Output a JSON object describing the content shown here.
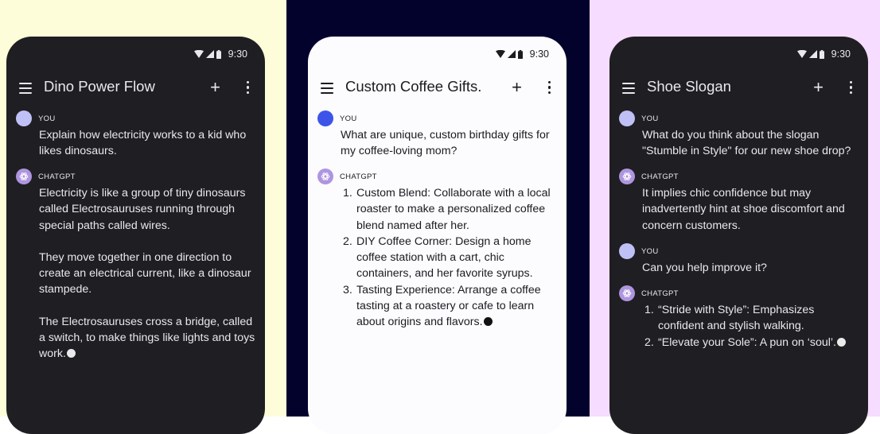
{
  "colors": {
    "bg_left": "#fdfdd9",
    "bg_mid": "#02022d",
    "bg_right": "#f6dcfe",
    "dark_surface": "#1f1e22",
    "light_surface": "#fcfbfe"
  },
  "phones": [
    {
      "status_time": "9:30",
      "title": "Dino Power Flow",
      "messages": [
        {
          "sender": "YOU",
          "text": "Explain how electricity works to a kid who likes dinosaurs."
        },
        {
          "sender": "CHATGPT",
          "paragraphs": [
            "Electricity is like a group of tiny dinosaurs called Electrosauruses running through special paths called wires.",
            "They move together in one direction to create an electrical current, like a dinosaur stampede.",
            "The Electrosauruses cross a bridge, called a switch, to make things like lights and toys work."
          ]
        }
      ]
    },
    {
      "status_time": "9:30",
      "title": "Custom Coffee Gifts.",
      "messages": [
        {
          "sender": "YOU",
          "text": "What are unique, custom birthday gifts for my coffee-loving mom?"
        },
        {
          "sender": "CHATGPT",
          "list": [
            {
              "n": "1.",
              "text": "Custom Blend: Collaborate with a local roaster to make a personalized coffee blend named after her."
            },
            {
              "n": "2.",
              "text": "DIY Coffee Corner: Design a home coffee station with a cart, chic containers, and her favorite syrups."
            },
            {
              "n": "3.",
              "text": "Tasting Experience: Arrange a coffee tasting at a roastery or cafe to learn about origins and flavors."
            }
          ]
        }
      ]
    },
    {
      "status_time": "9:30",
      "title": "Shoe Slogan",
      "messages": [
        {
          "sender": "YOU",
          "text": "What do you think about the slogan \"Stumble in Style\" for our new shoe drop?"
        },
        {
          "sender": "CHATGPT",
          "text": "It implies chic confidence but may inadvertently hint at shoe discomfort and concern customers."
        },
        {
          "sender": "YOU",
          "text": "Can you help improve it?"
        },
        {
          "sender": "CHATGPT",
          "list": [
            {
              "n": "1.",
              "text": "“Stride with Style”: Emphasizes confident and stylish walking."
            },
            {
              "n": "2.",
              "text": "“Elevate your Sole”: A pun on ‘soul’."
            }
          ]
        }
      ]
    }
  ]
}
